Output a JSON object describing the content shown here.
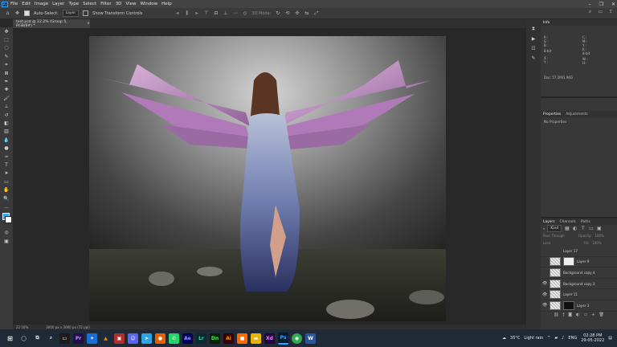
{
  "menubar": {
    "logo": "Ps",
    "items": [
      "File",
      "Edit",
      "Image",
      "Layer",
      "Type",
      "Select",
      "Filter",
      "3D",
      "View",
      "Window",
      "Help"
    ]
  },
  "optionsbar": {
    "auto_select_label": "Auto-Select:",
    "auto_select_value": "Layer",
    "transform_label": "Show Transform Controls",
    "mode_label": "3D Mode:"
  },
  "document": {
    "tab_title": "test.psd @ 22.2% (Group 5, RGB/8#) *",
    "zoom": "22.16%",
    "dimensions": "3000 px x 3000 px (72 ppi)"
  },
  "info_panel": {
    "tab": "Info",
    "r_label": "R :",
    "g_label": "G :",
    "b_label": "B :",
    "c_label": "C :",
    "m_label": "M :",
    "y_label": "Y :",
    "k_label": "K :",
    "bit1": "8-bit",
    "bit2": "8-bit",
    "x_label": "X :",
    "y2_label": "Y :",
    "w_label": "W :",
    "h_label": "H :",
    "doc": "Doc: 57.2M/1.96G"
  },
  "properties_panel": {
    "tabs": [
      "Properties",
      "Adjustments"
    ],
    "text": "No Properties"
  },
  "layers_panel": {
    "tabs": [
      "Layers",
      "Channels",
      "Paths"
    ],
    "filter": "Kind",
    "blend_mode": "Pass Through",
    "opacity_label": "Opacity:",
    "opacity_value": "100%",
    "lock_label": "Lock:",
    "fill_label": "Fill:",
    "fill_value": "100%",
    "layers": [
      {
        "name": "Layer 17",
        "visible": false
      },
      {
        "name": "Layer 9",
        "visible": false
      },
      {
        "name": "Background copy 4",
        "visible": false
      },
      {
        "name": "Background copy 3",
        "visible": true
      },
      {
        "name": "Layer 11",
        "visible": true
      },
      {
        "name": "Layer 3",
        "visible": true
      }
    ]
  },
  "taskbar": {
    "weather_temp": "35°C",
    "weather_text": "Light rain",
    "lang": "ENG",
    "time": "02:28 PM",
    "date": "29-05-2022"
  }
}
